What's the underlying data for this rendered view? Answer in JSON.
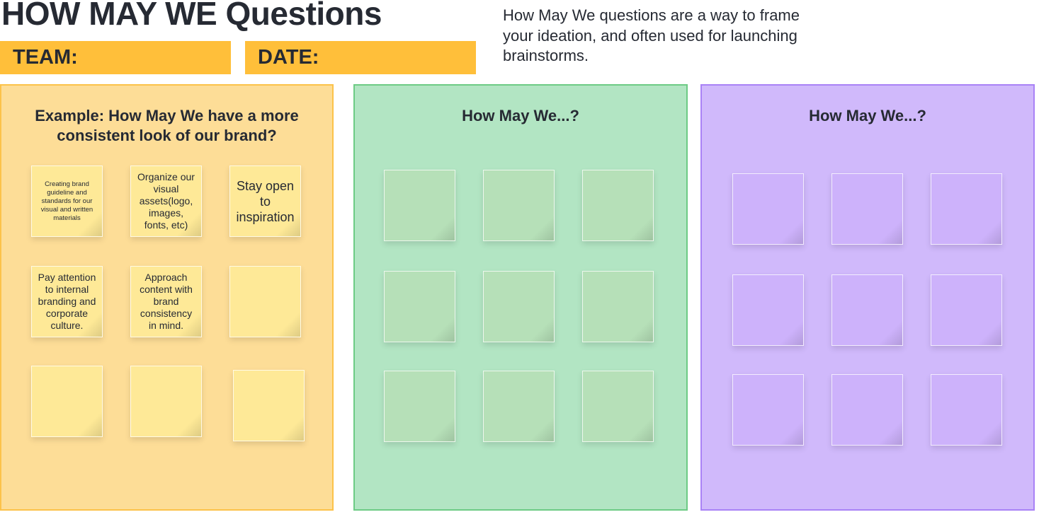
{
  "header": {
    "title": "HOW MAY WE Questions",
    "team_label": "TEAM:",
    "date_label": "DATE:",
    "description": "How May We questions are a way to frame your ideation, and often used for launching brainstorms."
  },
  "boards": [
    {
      "title": "Example: How May We have a more consistent look of our brand?",
      "color": "#fddd97",
      "notes": [
        "Creating brand guideline and standards for our visual and written materials",
        "Organize our visual assets(logo, images, fonts, etc)",
        "Stay open to inspiration",
        "Pay attention to internal branding and corporate culture.",
        "Approach content with brand consistency in mind.",
        "",
        "",
        "",
        ""
      ]
    },
    {
      "title": "How May We...?",
      "color": "#b2e5c3",
      "notes": [
        "",
        "",
        "",
        "",
        "",
        "",
        "",
        "",
        ""
      ]
    },
    {
      "title": "How May We...?",
      "color": "#d0b9fb",
      "notes": [
        "",
        "",
        "",
        "",
        "",
        "",
        "",
        "",
        ""
      ]
    }
  ]
}
